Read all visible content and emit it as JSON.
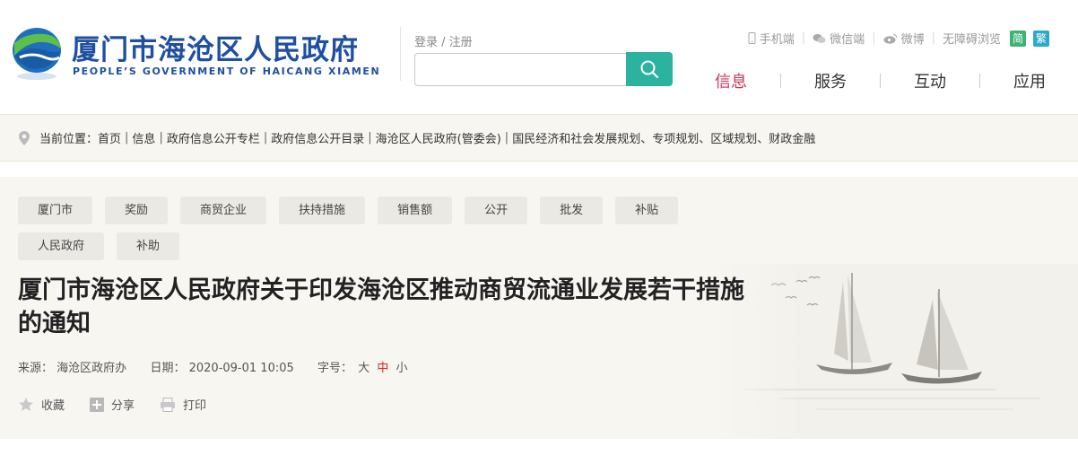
{
  "header": {
    "title": "厦门市海沧区人民政府",
    "subtitle": "PEOPLE’S GOVERNMENT OF HAICANG XIAMEN",
    "login": "登录 / 注册",
    "search": {
      "value": "",
      "placeholder": ""
    },
    "toplinks": [
      {
        "label": "手机端",
        "icon": "mobile-icon"
      },
      {
        "label": "微信端",
        "icon": "wechat-icon"
      },
      {
        "label": "微博",
        "icon": "weibo-icon"
      },
      {
        "label": "无障碍浏览",
        "icon": ""
      }
    ],
    "lang_simplified": "简",
    "lang_traditional": "繁",
    "nav": [
      {
        "label": "信息",
        "active": true
      },
      {
        "label": "服务",
        "active": false
      },
      {
        "label": "互动",
        "active": false
      },
      {
        "label": "应用",
        "active": false
      }
    ]
  },
  "breadcrumb": {
    "prefix": "当前位置：",
    "items": [
      "首页",
      "信息",
      "政府信息公开专栏",
      "政府信息公开目录",
      "海沧区人民政府(管委会)",
      "国民经济和社会发展规划、专项规划、区域规划、财政金融"
    ]
  },
  "article": {
    "tags": [
      "厦门市",
      "奖励",
      "商贸企业",
      "扶持措施",
      "销售额",
      "公开",
      "批发",
      "补贴",
      "人民政府",
      "补助"
    ],
    "title": "厦门市海沧区人民政府关于印发海沧区推动商贸流通业发展若干措施的通知",
    "source_label": "来源：",
    "source": "海沧区政府办",
    "date_label": "日期：",
    "date": "2020-09-01 10:05",
    "fontsize_label": "字号：",
    "font_large": "大",
    "font_medium": "中",
    "font_small": "小",
    "favorite": "收藏",
    "share": "分享",
    "print": "打印"
  },
  "colors": {
    "brand_blue": "#1f4fa0",
    "search_teal": "#2cb3a0",
    "active_nav": "#c8375a"
  }
}
